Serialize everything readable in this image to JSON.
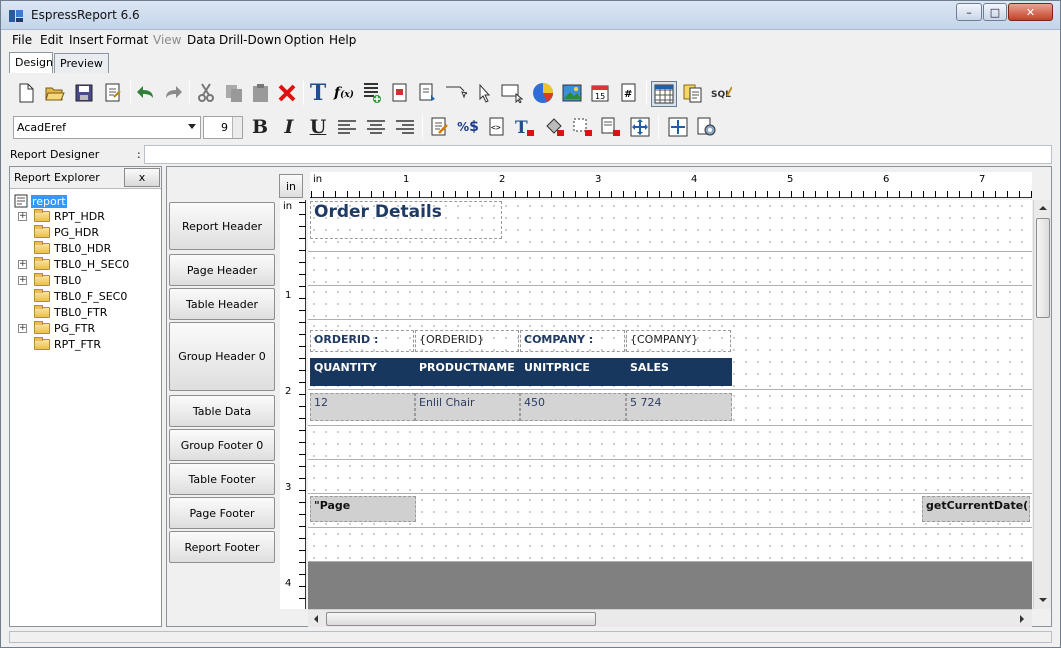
{
  "window": {
    "title": "EspressReport 6.6",
    "minimize": "–",
    "maximize": "□",
    "close": "✕"
  },
  "menu": [
    "File",
    "Edit",
    "Insert",
    "Format",
    "View",
    "Data",
    "Drill-Down",
    "Option",
    "Help"
  ],
  "tabs": [
    "Design",
    "Preview"
  ],
  "format_bar": {
    "font": "AcadEref",
    "size": "9"
  },
  "report_designer": {
    "label": "Report Designer",
    "colon": ":",
    "value": ""
  },
  "explorer": {
    "title": "Report Explorer",
    "close": "x",
    "root": "report",
    "nodes": [
      "RPT_HDR",
      "PG_HDR",
      "TBL0_HDR",
      "TBL0_H_SEC0",
      "TBL0",
      "TBL0_F_SEC0",
      "TBL0_FTR",
      "PG_FTR",
      "RPT_FTR"
    ]
  },
  "sections": [
    "Report Header",
    "Page Header",
    "Table Header",
    "Group Header 0",
    "Table Data",
    "Group Footer 0",
    "Table Footer",
    "Page Footer",
    "Report Footer"
  ],
  "ruler": {
    "unit_button": "in",
    "unit": "in",
    "h_labels": [
      "1",
      "2",
      "3",
      "4",
      "5",
      "6",
      "7"
    ],
    "v_labels": [
      "1",
      "2",
      "3",
      "4"
    ]
  },
  "report": {
    "title": "Order Details",
    "group_header": {
      "orderid_label": "ORDERID :",
      "orderid_value": "{ORDERID}",
      "company_label": "COMPANY :",
      "company_value": "{COMPANY}"
    },
    "columns": [
      "QUANTITY",
      "PRODUCTNAME",
      "UNITPRICE",
      "SALES"
    ],
    "row": [
      "12",
      "Enlil Chair",
      "450",
      "5 724"
    ],
    "page_footer_left": "\"Page",
    "page_footer_right": "getCurrentDate()"
  },
  "colors": {
    "header_fill": "#17375e",
    "title_text": "#1f3a64",
    "data_fill": "#d4d4d4"
  }
}
